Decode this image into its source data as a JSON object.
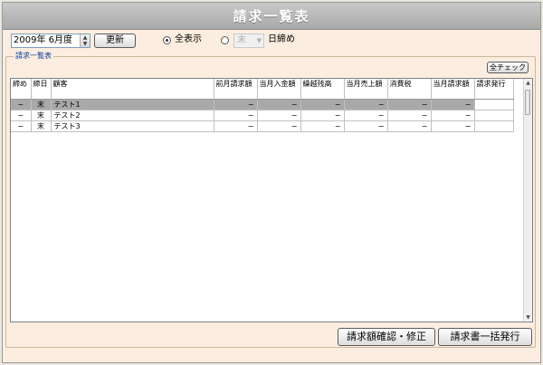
{
  "window": {
    "title": "請求一覧表"
  },
  "toolbar": {
    "month_value": "2009年 6月度",
    "refresh_label": "更新",
    "radio_all_label": "全表示",
    "day_value": "末",
    "day_suffix": "日締め"
  },
  "group": {
    "legend": "請求一覧表",
    "check_all_label": "全チェック"
  },
  "table": {
    "columns": [
      "締め",
      "締日",
      "顧客",
      "前月請求額",
      "当月入金額",
      "繰越残高",
      "当月売上額",
      "消費税",
      "当月請求額",
      "請求発行"
    ],
    "rows": [
      [
        "−",
        "末",
        "テスト1",
        "−",
        "−",
        "−",
        "−",
        "−",
        "−",
        ""
      ],
      [
        "−",
        "末",
        "テスト2",
        "−",
        "−",
        "−",
        "−",
        "−",
        "−",
        ""
      ],
      [
        "−",
        "末",
        "テスト3",
        "−",
        "−",
        "−",
        "−",
        "−",
        "−",
        ""
      ]
    ]
  },
  "footer": {
    "confirm_label": "請求額確認・修正",
    "issue_all_label": "請求書一括発行"
  }
}
